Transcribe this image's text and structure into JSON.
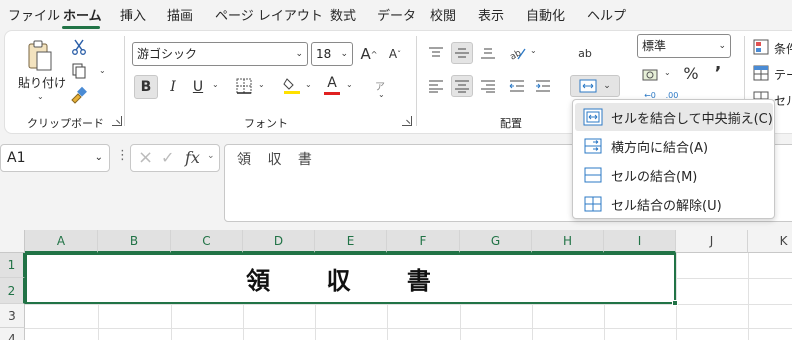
{
  "tabs": [
    "ファイル",
    "ホーム",
    "挿入",
    "描画",
    "ページ レイアウト",
    "数式",
    "データ",
    "校閲",
    "表示",
    "自動化",
    "ヘルプ"
  ],
  "active_tab": "ホーム",
  "clipboard": {
    "paste_label": "貼り付け",
    "group_label": "クリップボード"
  },
  "font": {
    "name": "游ゴシック",
    "size": "18",
    "group_label": "フォント",
    "bold": "B",
    "italic": "I",
    "underline": "U",
    "grow": "A",
    "shrink": "A",
    "color_letter": "A",
    "phonetic": "ア",
    "font_color": "#e02020",
    "highlight_color": "#ffe100"
  },
  "alignment": {
    "group_label": "配置",
    "wrap_label": "ab"
  },
  "number": {
    "format": "標準",
    "percent": "%",
    "comma": "’"
  },
  "styles": {
    "conditional": "条件",
    "table": "テー",
    "cell": "セル"
  },
  "formula_bar": {
    "name_box": "A1",
    "fx": "fx",
    "content": "領 収 書",
    "cancel": "×",
    "confirm": "✓"
  },
  "columns": [
    "A",
    "B",
    "C",
    "D",
    "E",
    "F",
    "G",
    "H",
    "I",
    "J",
    "K"
  ],
  "rows": [
    "1",
    "2",
    "3",
    "4"
  ],
  "merged_cell": {
    "text": "領 収 書"
  },
  "merge_menu": [
    {
      "label": "セルを結合して中央揃え(C)",
      "icon": "merge-center-icon"
    },
    {
      "label": "横方向に結合(A)",
      "icon": "merge-across-icon"
    },
    {
      "label": "セルの結合(M)",
      "icon": "merge-cells-icon"
    },
    {
      "label": "セル結合の解除(U)",
      "icon": "unmerge-cells-icon"
    }
  ],
  "colors": {
    "accent": "#217346",
    "menu_icon_blue": "#2b78c5"
  }
}
